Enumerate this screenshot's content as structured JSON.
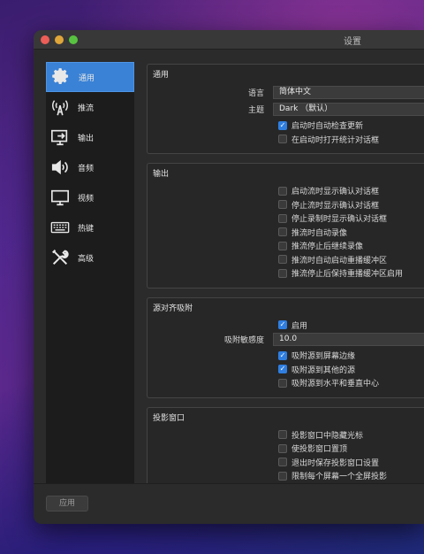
{
  "window": {
    "title": "设置"
  },
  "sidebar": {
    "items": [
      {
        "label": "通用",
        "icon": "gear-icon",
        "active": true
      },
      {
        "label": "推流",
        "icon": "broadcast-icon",
        "active": false
      },
      {
        "label": "输出",
        "icon": "output-icon",
        "active": false
      },
      {
        "label": "音频",
        "icon": "speaker-icon",
        "active": false
      },
      {
        "label": "视频",
        "icon": "monitor-icon",
        "active": false
      },
      {
        "label": "热键",
        "icon": "keyboard-icon",
        "active": false
      },
      {
        "label": "高级",
        "icon": "tools-icon",
        "active": false
      }
    ]
  },
  "general": {
    "title": "通用",
    "language_label": "语言",
    "language_value": "简体中文",
    "theme_label": "主题",
    "theme_value": "Dark （默认）",
    "checks": [
      {
        "label": "启动时自动检查更新",
        "checked": true
      },
      {
        "label": "在启动时打开统计对话框",
        "checked": false
      }
    ]
  },
  "output": {
    "title": "输出",
    "checks": [
      {
        "label": "启动流时显示确认对话框",
        "checked": false
      },
      {
        "label": "停止流时显示确认对话框",
        "checked": false
      },
      {
        "label": "停止录制时显示确认对话框",
        "checked": false
      },
      {
        "label": "推流时自动录像",
        "checked": false
      },
      {
        "label": "推流停止后继续录像",
        "checked": false
      },
      {
        "label": "推流时自动启动重播缓冲区",
        "checked": false
      },
      {
        "label": "推流停止后保持重播缓冲区启用",
        "checked": false
      }
    ]
  },
  "snapping": {
    "title": "源对齐吸附",
    "enable": {
      "label": "启用",
      "checked": true
    },
    "sensitivity_label": "吸附敏感度",
    "sensitivity_value": "10.0",
    "checks": [
      {
        "label": "吸附源到屏幕边缘",
        "checked": true
      },
      {
        "label": "吸附源到其他的源",
        "checked": true
      },
      {
        "label": "吸附源到水平和垂直中心",
        "checked": false
      }
    ]
  },
  "projector": {
    "title": "投影窗口",
    "checks": [
      {
        "label": "投影窗口中隐藏光标",
        "checked": false
      },
      {
        "label": "使投影窗口置顶",
        "checked": false
      },
      {
        "label": "退出时保存投影窗口设置",
        "checked": false
      },
      {
        "label": "限制每个屏幕一个全屏投影",
        "checked": false
      }
    ]
  },
  "footer": {
    "apply_label": "应用"
  },
  "colors": {
    "accent": "#3a82d6",
    "checkbox_on": "#2f7ee0",
    "window_bg": "#2b2b2b"
  }
}
